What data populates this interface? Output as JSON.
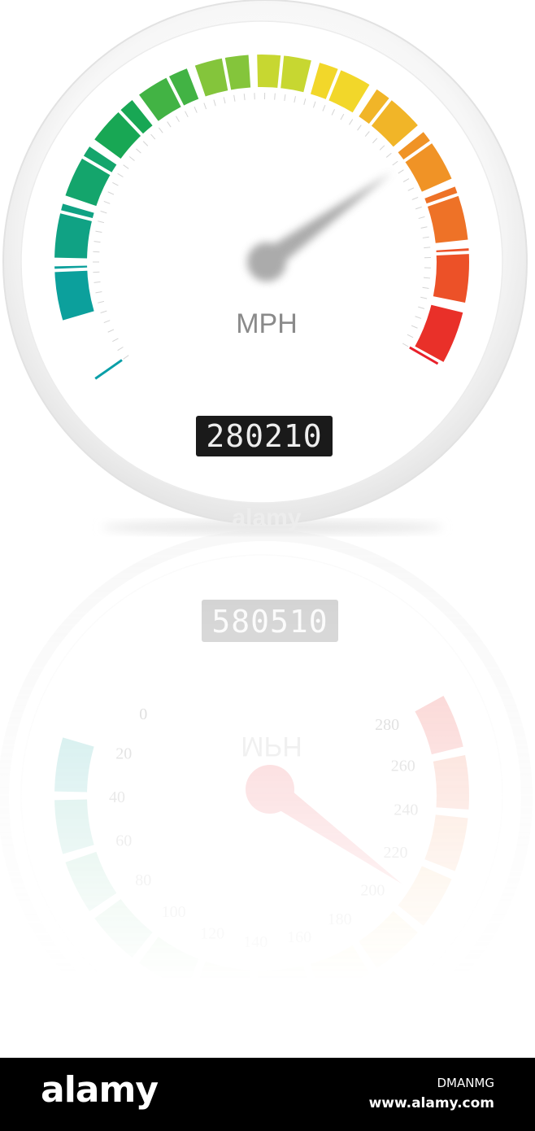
{
  "gauge": {
    "unit_label": "MPH",
    "odometer": "280210",
    "min": 0,
    "max": 280,
    "needle_value": 205,
    "tick_labels": [
      "0",
      "20",
      "40",
      "60",
      "80",
      "100",
      "120",
      "140",
      "160",
      "180",
      "200",
      "220",
      "240",
      "260",
      "280"
    ],
    "colors": {
      "low": "#0a9fa8",
      "green": "#1aa84a",
      "yellow": "#f2e32b",
      "orange": "#f08a26",
      "high": "#e8202a"
    }
  },
  "reflection": {
    "odometer": "580510",
    "unit_label": "MPH"
  },
  "watermark": {
    "mark": "alamy"
  },
  "footer": {
    "brand": "alamy",
    "image_id": "DMANMG",
    "site": "www.alamy.com"
  }
}
